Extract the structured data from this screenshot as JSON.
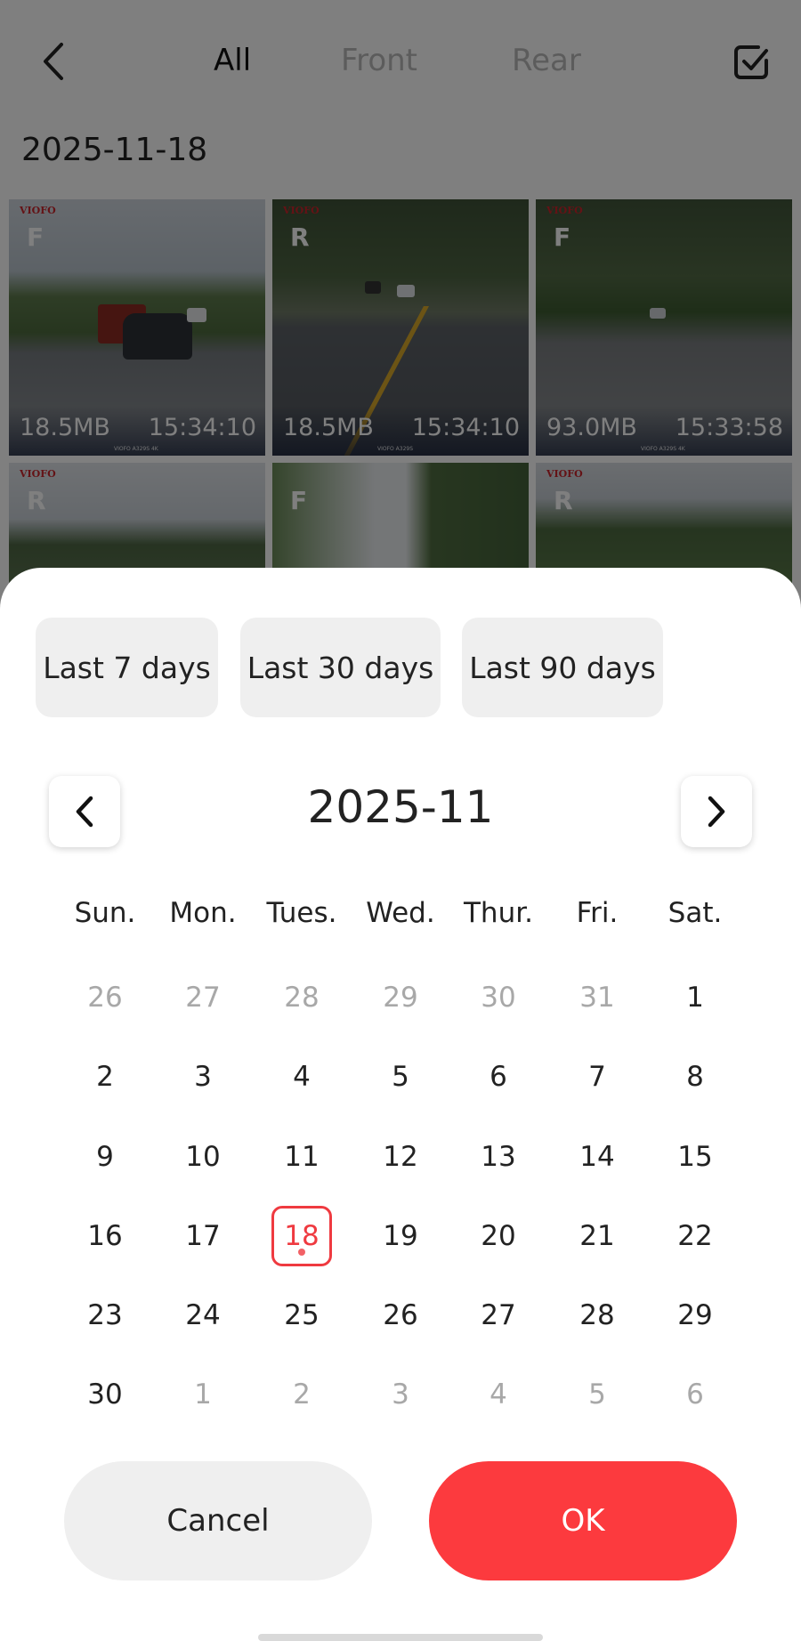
{
  "header": {
    "back_icon": "chevron-left-icon",
    "tabs": [
      {
        "label": "All",
        "active": true
      },
      {
        "label": "Front",
        "active": false
      },
      {
        "label": "Rear",
        "active": false
      }
    ],
    "select_icon": "checkbox-checked-icon"
  },
  "gallery": {
    "date": "2025-11-18",
    "thumbnails": [
      {
        "camera": "F",
        "size": "18.5MB",
        "time": "15:34:10",
        "logo": "VIOFO",
        "watermark": "VIOFO  A329S  4K"
      },
      {
        "camera": "R",
        "size": "18.5MB",
        "time": "15:34:10",
        "logo": "VIOFO",
        "watermark": "VIOFO  A329S"
      },
      {
        "camera": "F",
        "size": "93.0MB",
        "time": "15:33:58",
        "logo": "VIOFO",
        "watermark": "VIOFO  A329S  4K"
      },
      {
        "camera": "R",
        "size": "",
        "time": "",
        "logo": "VIOFO",
        "watermark": ""
      },
      {
        "camera": "F",
        "size": "",
        "time": "",
        "logo": "",
        "watermark": ""
      },
      {
        "camera": "R",
        "size": "",
        "time": "",
        "logo": "VIOFO",
        "watermark": ""
      }
    ]
  },
  "date_picker": {
    "quick_ranges": [
      "Last 7 days",
      "Last 30 days",
      "Last 90 days"
    ],
    "month_label": "2025-11",
    "prev_icon": "chevron-left-icon",
    "next_icon": "chevron-right-icon",
    "weekdays": [
      "Sun.",
      "Mon.",
      "Tues.",
      "Wed.",
      "Thur.",
      "Fri.",
      "Sat."
    ],
    "weeks": [
      [
        {
          "d": "26",
          "m": true
        },
        {
          "d": "27",
          "m": true
        },
        {
          "d": "28",
          "m": true
        },
        {
          "d": "29",
          "m": true
        },
        {
          "d": "30",
          "m": true
        },
        {
          "d": "31",
          "m": true
        },
        {
          "d": "1"
        }
      ],
      [
        {
          "d": "2"
        },
        {
          "d": "3"
        },
        {
          "d": "4"
        },
        {
          "d": "5"
        },
        {
          "d": "6"
        },
        {
          "d": "7"
        },
        {
          "d": "8"
        }
      ],
      [
        {
          "d": "9"
        },
        {
          "d": "10"
        },
        {
          "d": "11"
        },
        {
          "d": "12"
        },
        {
          "d": "13"
        },
        {
          "d": "14"
        },
        {
          "d": "15"
        }
      ],
      [
        {
          "d": "16"
        },
        {
          "d": "17"
        },
        {
          "d": "18",
          "selected": true
        },
        {
          "d": "19"
        },
        {
          "d": "20"
        },
        {
          "d": "21"
        },
        {
          "d": "22"
        }
      ],
      [
        {
          "d": "23"
        },
        {
          "d": "24"
        },
        {
          "d": "25"
        },
        {
          "d": "26"
        },
        {
          "d": "27"
        },
        {
          "d": "28"
        },
        {
          "d": "29"
        }
      ],
      [
        {
          "d": "30"
        },
        {
          "d": "1",
          "m": true
        },
        {
          "d": "2",
          "m": true
        },
        {
          "d": "3",
          "m": true
        },
        {
          "d": "4",
          "m": true
        },
        {
          "d": "5",
          "m": true
        },
        {
          "d": "6",
          "m": true
        }
      ]
    ],
    "cancel_label": "Cancel",
    "ok_label": "OK"
  },
  "colors": {
    "accent": "#fc3a3e",
    "selected_day": "#ef3a40",
    "chip_bg": "#efefef",
    "muted_text": "#a8a8a8"
  }
}
